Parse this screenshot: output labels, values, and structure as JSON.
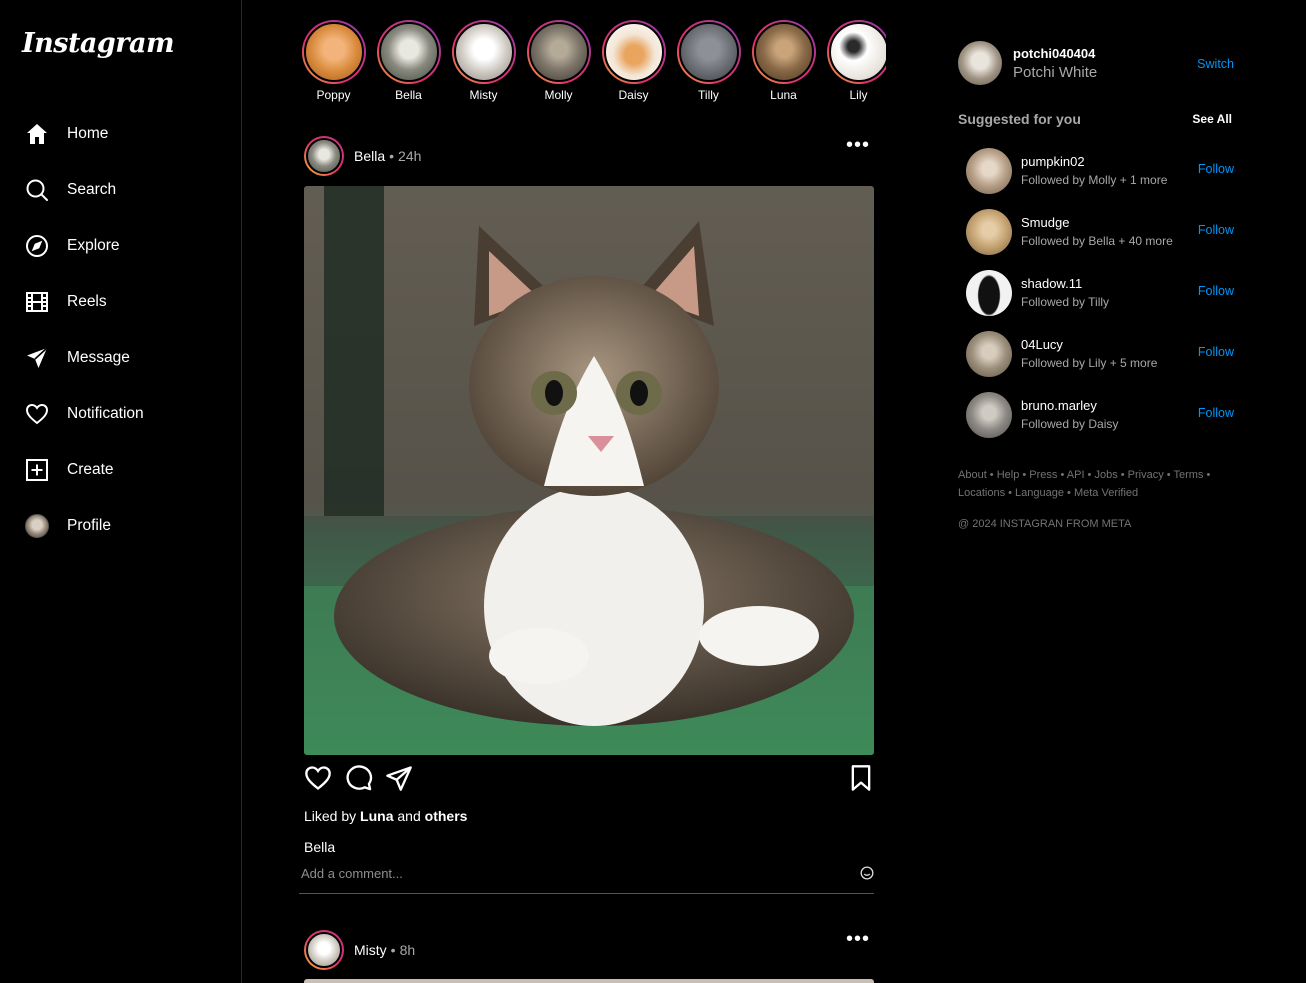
{
  "app": {
    "logo": "Instagram"
  },
  "nav": [
    {
      "label": "Home",
      "icon": "home-icon"
    },
    {
      "label": "Search",
      "icon": "search-icon"
    },
    {
      "label": "Explore",
      "icon": "compass-icon"
    },
    {
      "label": "Reels",
      "icon": "reels-icon"
    },
    {
      "label": "Message",
      "icon": "send-icon"
    },
    {
      "label": "Notification",
      "icon": "heart-icon"
    },
    {
      "label": "Create",
      "icon": "plus-square-icon"
    },
    {
      "label": "Profile",
      "icon": "avatar"
    }
  ],
  "stories": [
    {
      "name": "Poppy",
      "color": "#d98a3c"
    },
    {
      "name": "Bella",
      "color": "#8a8a80"
    },
    {
      "name": "Misty",
      "color": "#cfcac2"
    },
    {
      "name": "Molly",
      "color": "#7d7569"
    },
    {
      "name": "Daisy",
      "color": "#e8d3bb"
    },
    {
      "name": "Tilly",
      "color": "#6b6e74"
    },
    {
      "name": "Luna",
      "color": "#8a6a48"
    },
    {
      "name": "Lily",
      "color": "#e6e1da"
    }
  ],
  "posts": [
    {
      "user": "Bella",
      "time": "24h",
      "liked_prefix": "Liked by",
      "liked_user": "Luna",
      "liked_and": "and",
      "liked_others": "others",
      "caption": "Bella",
      "comment_placeholder": "Add a comment..."
    },
    {
      "user": "Misty",
      "time": "8h"
    }
  ],
  "me": {
    "handle": "potchi040404",
    "full_name": "Potchi White",
    "switch": "Switch"
  },
  "suggestions": {
    "title": "Suggested for you",
    "see_all": "See All",
    "follow_label": "Follow",
    "items": [
      {
        "user": "pumpkin02",
        "followed": "Followed by Molly + 1 more",
        "color": "#b8a088"
      },
      {
        "user": "Smudge",
        "followed": "Followed by Bella + 40 more",
        "color": "#c7a574"
      },
      {
        "user": "shadow.11",
        "followed": "Followed by Tilly",
        "color": "#f2f2f2"
      },
      {
        "user": "04Lucy",
        "followed": "Followed by Lily + 5 more",
        "color": "#9c8f7c"
      },
      {
        "user": "bruno.marley",
        "followed": "Followed by Daisy",
        "color": "#8d8a85"
      }
    ]
  },
  "footer": {
    "links": "About • Help • Press • API • Jobs • Privacy • Terms • Locations • Language • Meta Verified",
    "copyright": "@ 2024 INSTAGRAN FROM META"
  }
}
